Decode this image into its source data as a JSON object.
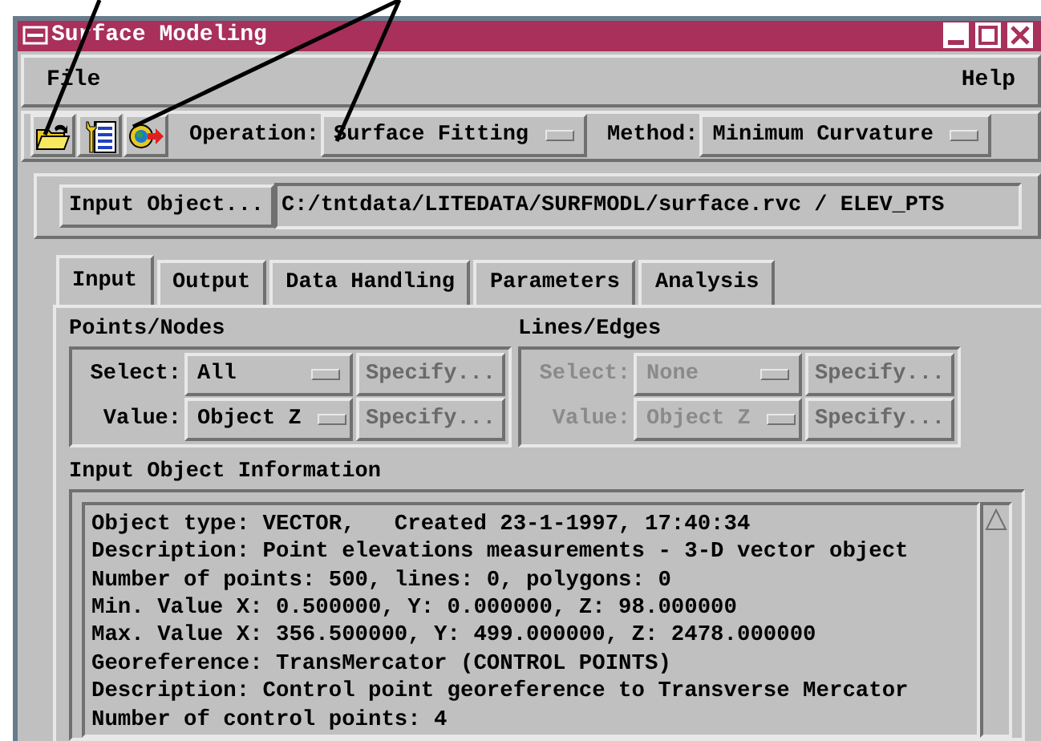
{
  "window": {
    "title": "Surface Modeling"
  },
  "menu": [
    {
      "label": "File"
    },
    {
      "label": "Help"
    }
  ],
  "toolbar": {
    "selectors": [
      {
        "label": "Operation:",
        "value": "Surface Fitting"
      },
      {
        "label": "Method:",
        "value": "Minimum Curvature"
      }
    ]
  },
  "input_object": {
    "button": "Input Object...",
    "path": "C:/tntdata/LITEDATA/SURFMODL/surface.rvc / ELEV_PTS"
  },
  "tabs": [
    {
      "label": "Input",
      "selected": true
    },
    {
      "label": "Output",
      "selected": false
    },
    {
      "label": "Data Handling",
      "selected": false
    },
    {
      "label": "Parameters",
      "selected": false
    },
    {
      "label": "Analysis",
      "selected": false
    }
  ],
  "groups": [
    {
      "title": "Points/Nodes",
      "rows": [
        {
          "label": "Select:",
          "value": "All",
          "disabled": false,
          "specify": {
            "label": "Specify...",
            "disabled": true
          }
        },
        {
          "label": "Value:",
          "value": "Object Z",
          "disabled": false,
          "specify": {
            "label": "Specify...",
            "disabled": true
          }
        }
      ]
    },
    {
      "title": "Lines/Edges",
      "rows": [
        {
          "label": "Select:",
          "value": "None",
          "disabled": true,
          "specify": {
            "label": "Specify...",
            "disabled": true
          }
        },
        {
          "label": "Value:",
          "value": "Object Z",
          "disabled": true,
          "specify": {
            "label": "Specify...",
            "disabled": true
          }
        }
      ]
    }
  ],
  "info": {
    "title": "Input Object Information",
    "lines": [
      "Object type: VECTOR,   Created 23-1-1997, 17:40:34",
      "Description: Point elevations measurements - 3-D vector object",
      "Number of points: 500, lines: 0, polygons: 0",
      "Min. Value X: 0.500000, Y: 0.000000, Z: 98.000000",
      "Max. Value X: 356.500000, Y: 499.000000, Z: 2478.000000",
      "Georeference: TransMercator (CONTROL POINTS)",
      "Description: Control point georeference to Transverse Mercator",
      "Number of control points: 4"
    ]
  }
}
